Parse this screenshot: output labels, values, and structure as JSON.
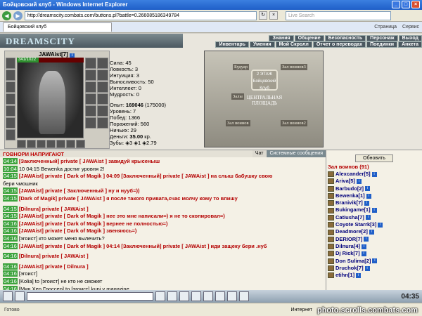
{
  "window": {
    "title": "Бойцовский клуб - Windows Internet Explorer"
  },
  "address": {
    "url": "http://dreamscity.combats.com/buttons.pl?battle=0.266085186349784",
    "search_placeholder": "Live Search"
  },
  "tab": {
    "label": "Бойцовский клуб",
    "tools": [
      "Страница",
      "Сервис"
    ]
  },
  "game": {
    "logo": "DREAMSCITY",
    "menu_top": [
      "Знания",
      "Общение",
      "Безопасность",
      "Персонаж",
      "Выход"
    ],
    "menu_bottom": [
      "Инвентарь",
      "Умения",
      "Мой Скролл",
      "Отчет о переводах",
      "Поединки",
      "Анкета"
    ],
    "character": {
      "name": "JAWAist",
      "level": "[7]",
      "hp": "341/1022",
      "hp_fraction": 0.33,
      "stats": [
        "Сила: 45",
        "Ловкость: 3",
        "Интуиция: 3",
        "Выносливость: 50",
        "Интеллект: 0",
        "Мудрость: 0"
      ],
      "exp_label": "Опыт:",
      "exp": "169046",
      "exp_next": "(175000)",
      "extra": [
        "Уровень: 7",
        "Побед: 1366",
        "Поражений: 560",
        "Ничьих: 29"
      ],
      "money_label": "Деньги:",
      "money": "35.00",
      "money_unit": "кр.",
      "teeth": "Зубы: ◈3 ◈1 ◈2.79"
    },
    "map": {
      "rooms": [
        "Будуар",
        "Зал воинов3",
        "Залы",
        "Зал воинов",
        "Зал воинов2"
      ],
      "center": "2 ЭТАЖ",
      "center_plate": "Бойцовский Клуб",
      "square": "ЦЕНТРАЛЬНАЯ ПЛОЩАДЬ"
    }
  },
  "chat": {
    "header": "ГОВНОРИ НАПРИГАЮТ",
    "tabs": [
      "Чат",
      "Системные сообщения"
    ],
    "messages": [
      {
        "time": "04:14",
        "text": "[Заключенный] private [ JAWAist ] завидуй крысеныш"
      },
      {
        "time": "10:04",
        "text": "10 04:15 Bewenka достиг уровня 2!"
      },
      {
        "time": "04:15",
        "text": "[JAWAist] private [ Dark of Magik ] 04:09 [Заключенный] private [ JAWAist ] на слыш бабушку свою"
      },
      {
        "time": "",
        "text": "бери чмошник"
      },
      {
        "time": "04:15",
        "text": "[JAWAist] private [ Заключенный ] ну и нууб=))"
      },
      {
        "time": "04:15",
        "text": "[Dark of Magik] private [ JAWAist ] я после такого привата,счас молчу кому то впишу"
      },
      {
        "time": "",
        "text": ""
      },
      {
        "time": "04:15",
        "text": "[Dilnura] private [ JAWAist ]"
      },
      {
        "time": "04:15",
        "text": "[JAWAist] private [ Dark of Magik ] нее это мне написали=) я не то скопировал=)"
      },
      {
        "time": "04:16",
        "text": "[JAWAist] private [ Dark of Magik ] вернее не полностью=)"
      },
      {
        "time": "04:16",
        "text": "[JAWAist] private [ Dark of Magik ] звеняюсь=)"
      },
      {
        "time": "04:16",
        "text": "[эгоист] кто может меня вылечить?"
      },
      {
        "time": "04:16",
        "text": "[JAWAist] private [ Dark of Magik ] 04:14 [Заключенный] private [ JAWAist ] иди защеку бери .нуб"
      },
      {
        "time": "",
        "text": ""
      },
      {
        "time": "04:16",
        "text": "[Dilnura] private [ JAWAist ]"
      },
      {
        "time": "",
        "text": ""
      },
      {
        "time": "04:16",
        "text": "[JAWAist] private [ Dilnura ]"
      },
      {
        "time": "04:16",
        "text": "[эгоист]"
      },
      {
        "time": "04:16",
        "text": "[Kolia] to [эгоист] не кто не сможет"
      },
      {
        "time": "04:16",
        "text": "[Мин Хер Гроссер] to [эгоист] kupi v magazine"
      }
    ]
  },
  "side": {
    "refresh": "Обновить",
    "room": "Зал воинов (91)",
    "players": [
      "Alexcander[5]",
      "Ariva[5]",
      "Barbudo[2]",
      "Bewenka[1]",
      "Branivik[7]",
      "Bukingame[1]",
      "Catiusha[7]",
      "Coyote Starrk[3]",
      "Deadmore[2]",
      "DERIOR[7]",
      "Dilnura[4]",
      "Dj Rick[7]",
      "Don Sulima[2]",
      "Druchok[7]",
      "etihn[1]"
    ]
  },
  "bottom": {
    "clock": "04:35"
  },
  "status": {
    "left": "Готово",
    "right": "Интернет",
    "watermark": "photo.scrolls.combats.com"
  }
}
